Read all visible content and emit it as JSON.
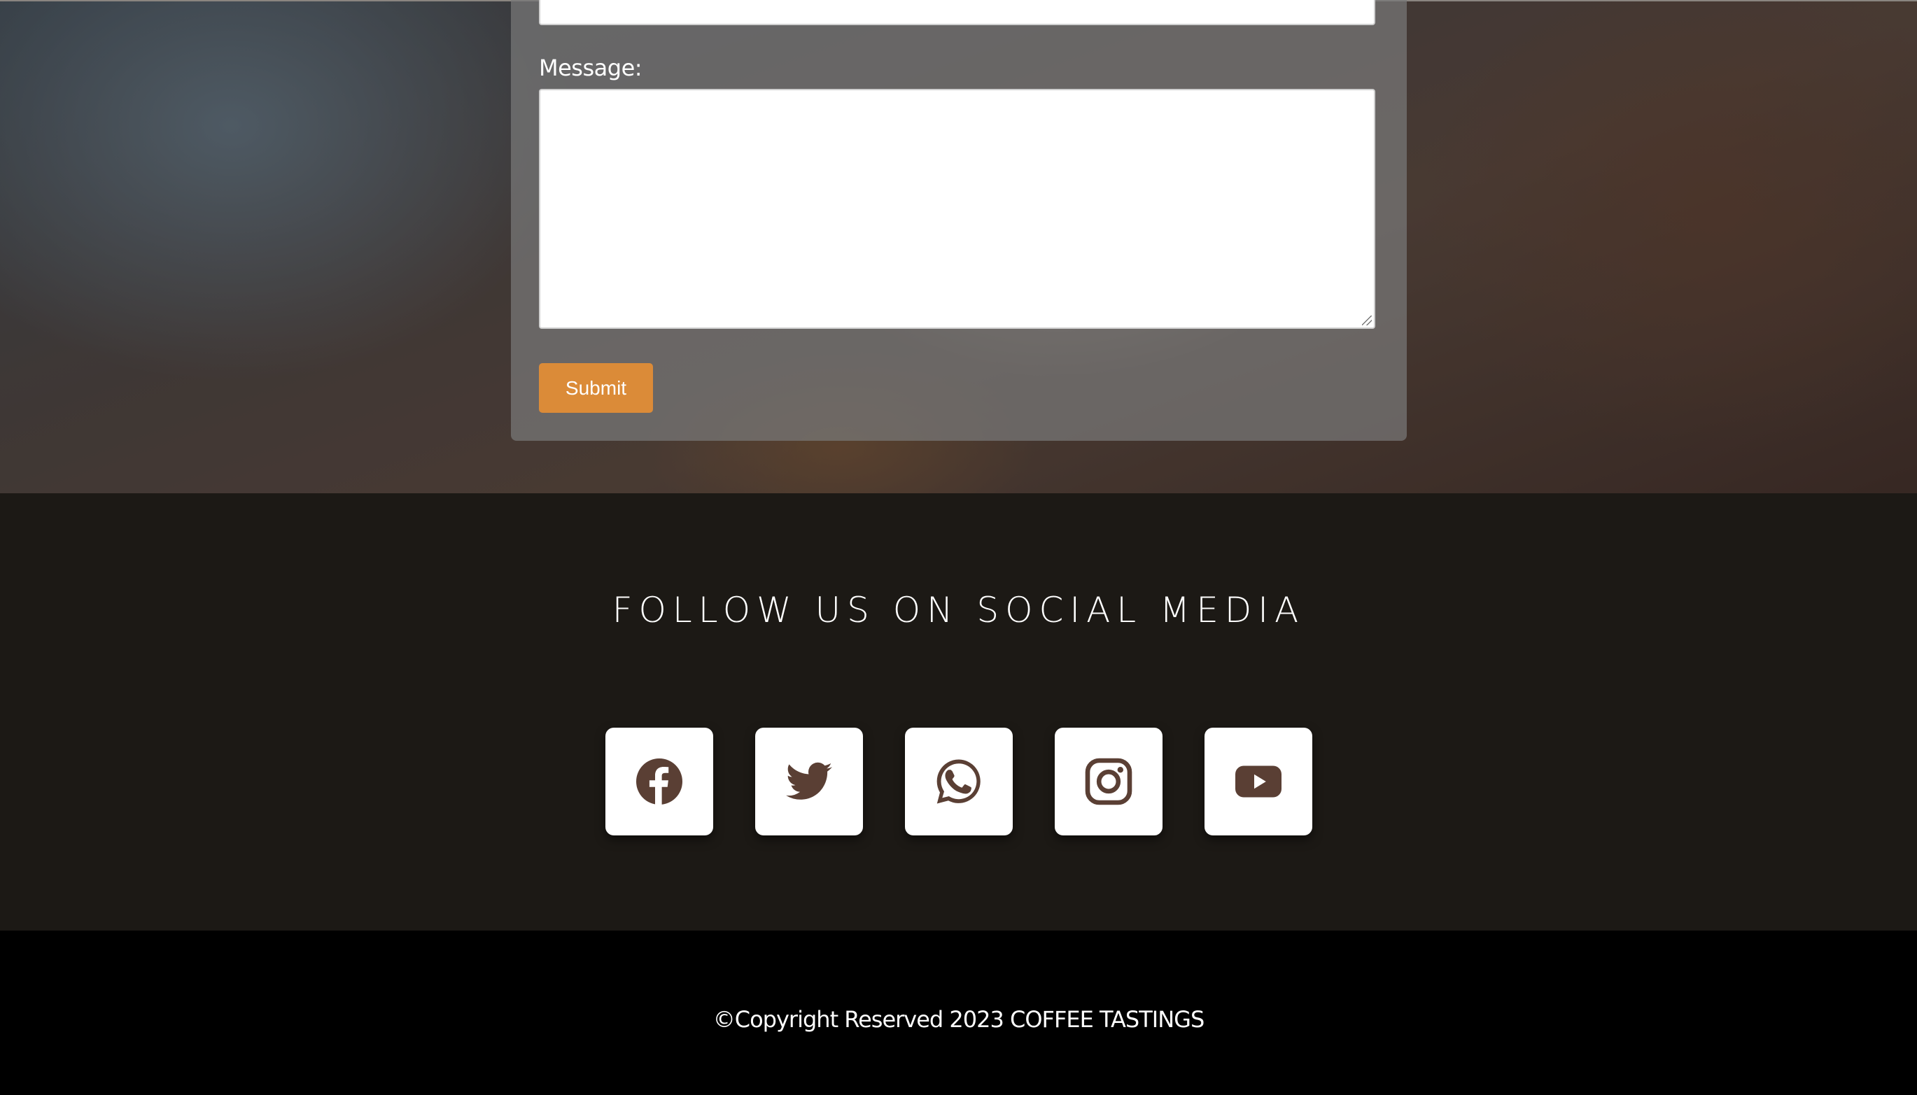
{
  "contact_form": {
    "message_label": "Message:",
    "message_value": "",
    "submit_label": "Submit"
  },
  "social": {
    "heading": "FOLLOW US ON SOCIAL MEDIA",
    "icons": [
      "facebook-icon",
      "twitter-icon",
      "whatsapp-icon",
      "instagram-icon",
      "youtube-icon"
    ],
    "icon_color": "#5a3f34"
  },
  "footer": {
    "copyright": "©Copyright Reserved 2023 COFFEE TASTINGS"
  },
  "colors": {
    "accent": "#db8b38",
    "social_bg": "#1c1915",
    "footer_bg": "#000000"
  }
}
